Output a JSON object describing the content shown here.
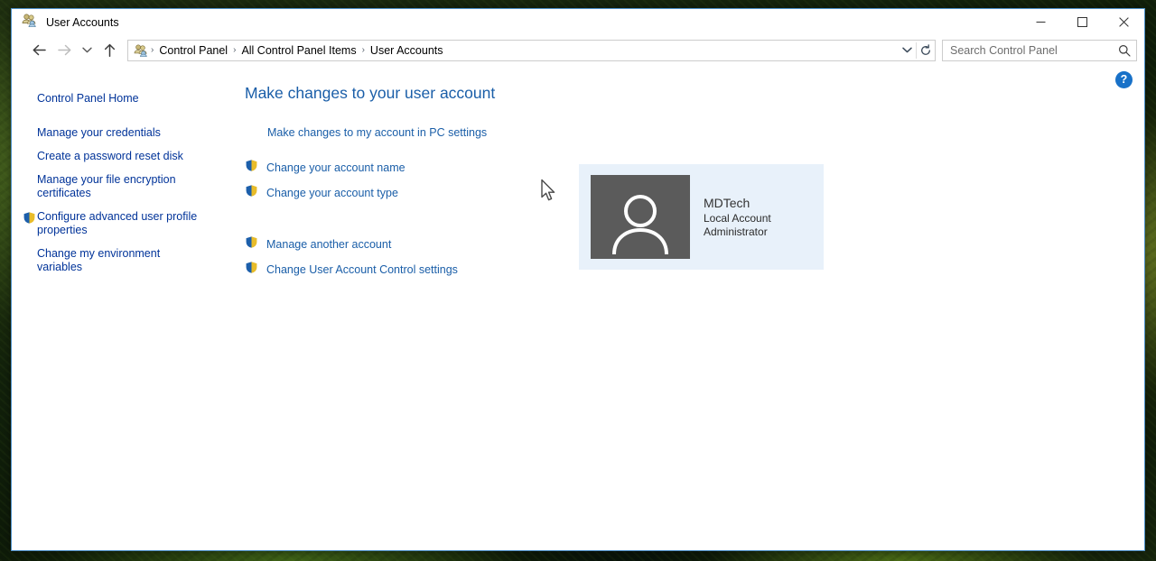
{
  "window": {
    "title": "User Accounts",
    "title_icon": "user-accounts-icon",
    "controls": {
      "minimize_label": "Minimize",
      "maximize_label": "Maximize",
      "close_label": "Close"
    }
  },
  "nav": {
    "back_label": "Back",
    "forward_label": "Forward",
    "recent_label": "Recent locations",
    "up_label": "Up",
    "breadcrumbs": [
      {
        "label": "Control Panel"
      },
      {
        "label": "All Control Panel Items"
      },
      {
        "label": "User Accounts"
      }
    ],
    "separator": "›",
    "dropdown_label": "Previous locations",
    "refresh_label": "Refresh"
  },
  "search": {
    "placeholder": "Search Control Panel",
    "value": "",
    "icon": "search-icon"
  },
  "sidebar": {
    "home_label": "Control Panel Home",
    "items": [
      {
        "label": "Manage your credentials",
        "shield": false
      },
      {
        "label": "Create a password reset disk",
        "shield": false
      },
      {
        "label": "Manage your file encryption certificates",
        "shield": false
      },
      {
        "label": "Configure advanced user profile properties",
        "shield": true
      },
      {
        "label": "Change my environment variables",
        "shield": false
      }
    ]
  },
  "main": {
    "heading": "Make changes to your user account",
    "pc_settings_link": "Make changes to my account in PC settings",
    "links_group_1": [
      {
        "label": "Change your account name",
        "shield": true
      },
      {
        "label": "Change your account type",
        "shield": true
      }
    ],
    "links_group_2": [
      {
        "label": "Manage another account",
        "shield": true
      },
      {
        "label": "Change User Account Control settings",
        "shield": true
      }
    ],
    "help_label": "?",
    "help_name": "help-icon"
  },
  "account": {
    "name": "MDTech",
    "type_line": "Local Account",
    "role_line": "Administrator",
    "avatar_icon": "user-avatar-icon"
  },
  "colors": {
    "link": "#1a5ea8",
    "sidebar_link": "#003399",
    "heading": "#1a5ea8",
    "tile_background": "#e8f1fa",
    "avatar_background": "#5b5b5b",
    "window_border": "#4d90c9",
    "help_blue": "#1871c8"
  }
}
